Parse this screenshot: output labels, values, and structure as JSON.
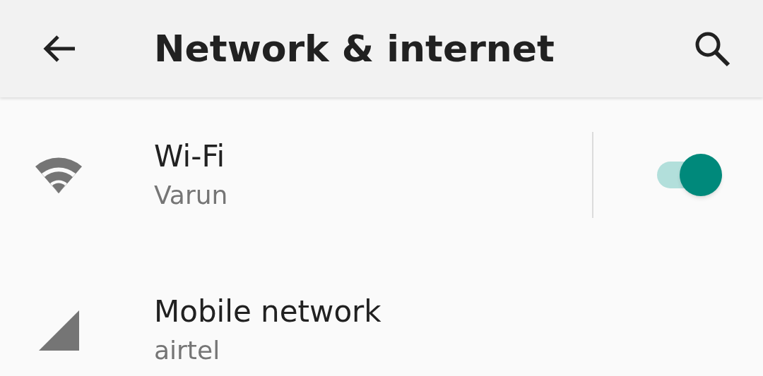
{
  "header": {
    "title": "Network & internet"
  },
  "items": [
    {
      "kind": "wifi",
      "title": "Wi-Fi",
      "subtitle": "Varun",
      "on": true
    },
    {
      "kind": "mobile",
      "title": "Mobile network",
      "subtitle": "airtel"
    }
  ]
}
